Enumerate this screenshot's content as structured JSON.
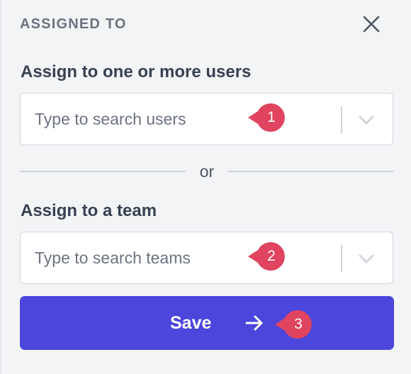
{
  "header": {
    "title": "ASSIGNED TO",
    "close_icon": "close-icon"
  },
  "users": {
    "label": "Assign to one or more users",
    "placeholder": "Type to search users",
    "value": "",
    "dropdown_icon": "chevron-down-icon"
  },
  "divider": {
    "text": "or"
  },
  "teams": {
    "label": "Assign to a team",
    "placeholder": "Type to search teams",
    "value": "",
    "dropdown_icon": "chevron-down-icon"
  },
  "save": {
    "label": "Save",
    "icon": "arrow-right-icon"
  },
  "annotations": [
    {
      "number": "1"
    },
    {
      "number": "2"
    },
    {
      "number": "3"
    }
  ],
  "colors": {
    "primary": "#4c46dc",
    "badge": "#e0445f",
    "panel_bg": "#f3f4f6",
    "text": "#374151",
    "muted": "#6b7280",
    "border": "#d1d5db"
  }
}
